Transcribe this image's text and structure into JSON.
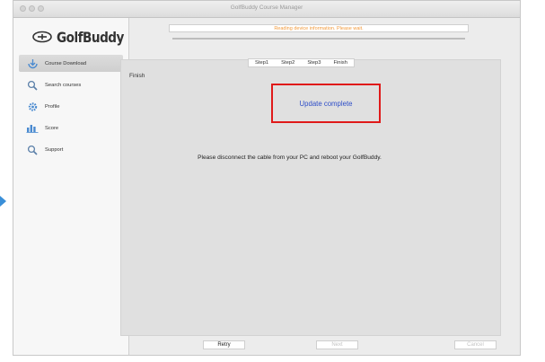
{
  "window": {
    "title": "GolfBuddy Course Manager"
  },
  "logo": {
    "text": "GolfBuddy"
  },
  "sidebar": {
    "items": [
      {
        "label": "Course Download",
        "icon": "download-icon",
        "active": true
      },
      {
        "label": "Search courses",
        "icon": "search-icon"
      },
      {
        "label": "Profile",
        "icon": "gear-icon"
      },
      {
        "label": "Score",
        "icon": "bar-chart-icon"
      },
      {
        "label": "Support",
        "icon": "search-icon"
      }
    ]
  },
  "header": {
    "progress_text": "Reading device information. Please wait."
  },
  "steps": [
    "Step1",
    "Step2",
    "Step3",
    "Finish"
  ],
  "main": {
    "section_label": "Finish",
    "status": "Update complete",
    "message": "Please disconnect the cable from your PC and reboot your GolfBuddy."
  },
  "buttons": {
    "retry": "Retry",
    "next": "Next",
    "cancel": "Cancel"
  },
  "colors": {
    "status_text": "#2e4ec8",
    "highlight_border": "#e01a1a",
    "progress_text": "#f29a3c"
  }
}
